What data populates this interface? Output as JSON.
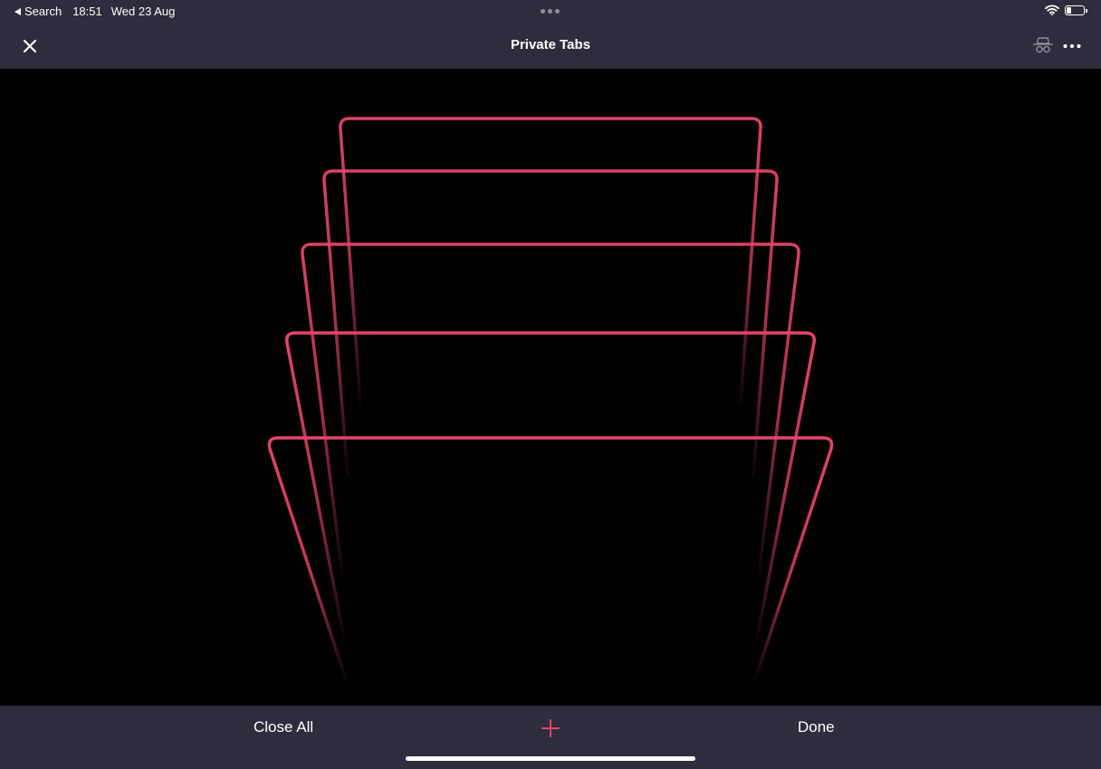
{
  "status_bar": {
    "back_app": "Search",
    "time": "18:51",
    "date": "Wed 23 Aug",
    "battery_level": 0.3
  },
  "nav_bar": {
    "title": "Private Tabs"
  },
  "toolbar": {
    "close_all_label": "Close All",
    "done_label": "Done"
  },
  "colors": {
    "accent": "#e8456b",
    "bar_background": "#2e2d3d",
    "content_background": "#000000"
  },
  "icons": {
    "close": "close-icon",
    "private_mode": "private-browsing-icon",
    "more": "more-icon",
    "new_tab": "plus-icon",
    "wifi": "wifi-icon",
    "battery": "battery-icon"
  }
}
